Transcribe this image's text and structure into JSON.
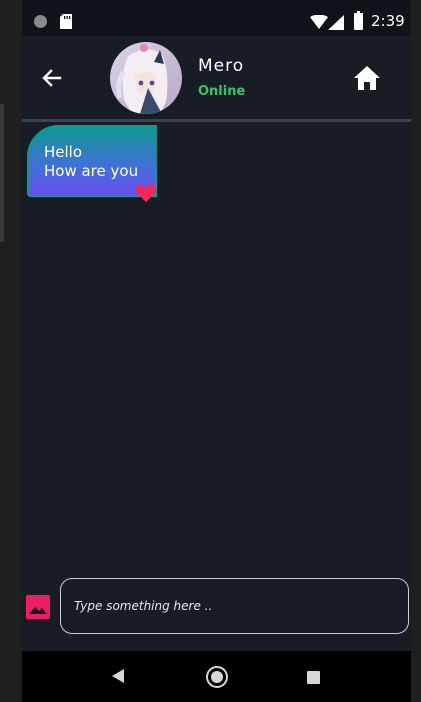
{
  "status_bar": {
    "time": "2:39",
    "icons": [
      "record-dot-icon",
      "sd-card-icon",
      "wifi-icon",
      "signal-icon",
      "battery-icon"
    ]
  },
  "header": {
    "contact_name": "Mero",
    "contact_status": "Online",
    "status_color": "#35c56a",
    "back_icon": "arrow-left-icon",
    "home_icon": "home-icon"
  },
  "messages": [
    {
      "lines": [
        "Hello",
        "How are you"
      ],
      "reaction": "heart-icon",
      "reaction_color": "#f0285a"
    }
  ],
  "composer": {
    "placeholder": "Type something here ..",
    "value": "",
    "attach_icon": "image-icon",
    "attach_color": "#e91e63"
  },
  "nav_bar": {
    "icons": [
      "nav-back-icon",
      "nav-home-icon",
      "nav-recents-icon"
    ]
  },
  "colors": {
    "background": "#171c25",
    "status_bar": "#0f141a",
    "bubble_top": "#0e9a8d",
    "bubble_bottom": "#6a4cf0"
  }
}
